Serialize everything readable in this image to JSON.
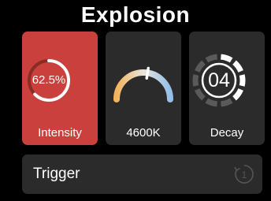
{
  "header": {
    "title": "Explosion"
  },
  "tiles": {
    "intensity": {
      "value_text": "62.5%",
      "label": "Intensity",
      "level": 0.625
    },
    "color_temp": {
      "label": "4600K",
      "level": 0.55
    },
    "decay": {
      "value_text": "04",
      "label": "Decay",
      "level": 0.4
    }
  },
  "trigger": {
    "label": "Trigger",
    "count": "1"
  },
  "colors": {
    "background": "#000000",
    "tile_bg": "#2b2b2b",
    "active_tile_bg": "#c9403c",
    "text": "#ffffff",
    "warm": "#f3b45a",
    "cool": "#93bfe9"
  },
  "icons": {
    "reset": "reset-counter-icon"
  }
}
